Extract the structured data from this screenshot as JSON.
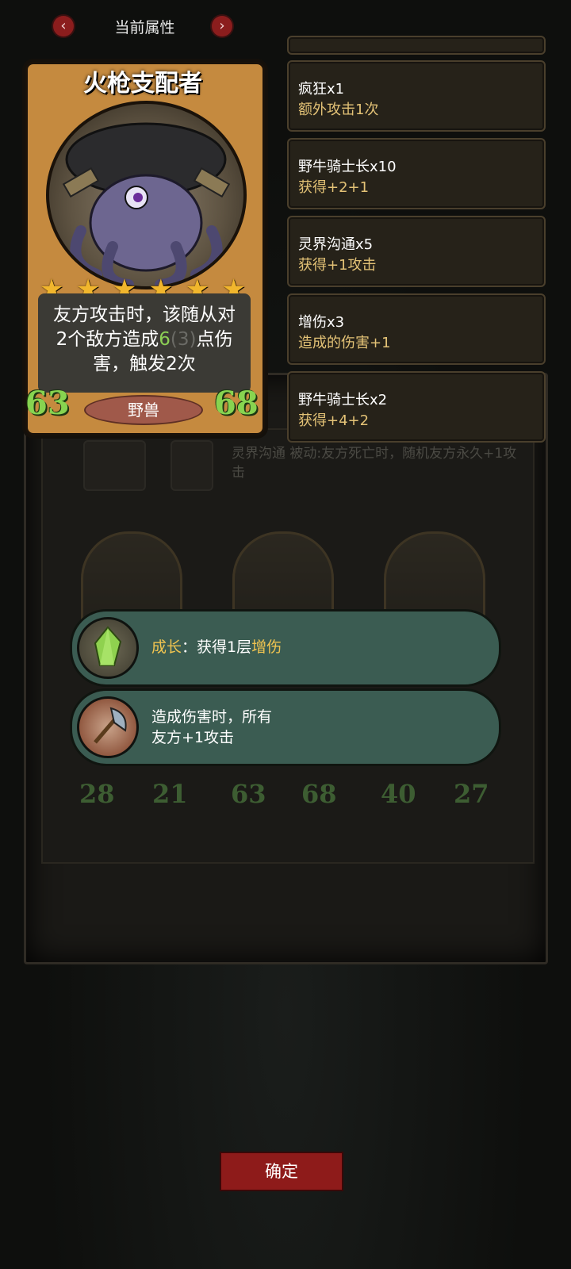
{
  "header": {
    "title": "当前属性",
    "prev_icon": "chevron-left-icon",
    "next_icon": "chevron-right-icon",
    "prev_glyph": "‹",
    "next_glyph": "›"
  },
  "hero": {
    "name": "火枪支配者",
    "stars": 6,
    "star_glyph": "★",
    "desc_1": "友方攻击时，该随从对",
    "desc_2a": "2个敌方造成",
    "desc_2b": "6",
    "desc_2c": "(3)",
    "desc_2d": "点伤",
    "desc_3": "害，触发2次",
    "attack": "63",
    "health": "68",
    "tribe": "野兽"
  },
  "buffs": [
    {
      "title": "疯狂x1",
      "effect": "额外攻击1次"
    },
    {
      "title": "野牛骑士长x10",
      "effect": "获得+2+1"
    },
    {
      "title": "灵界沟通x5",
      "effect": "获得+1攻击"
    },
    {
      "title": "增伤x3",
      "effect": "造成的伤害+1"
    },
    {
      "title": "野牛骑士长x2",
      "effect": "获得+4+2"
    }
  ],
  "background": {
    "skill_text": "灵界沟通 被动:友方死亡时，随机友方永久+1攻击",
    "cards": [
      {
        "attack": "28",
        "health": "21"
      },
      {
        "attack": "63",
        "health": "68"
      },
      {
        "attack": "40",
        "health": "27"
      }
    ]
  },
  "abilities": [
    {
      "icon": "green-crystal-icon",
      "label_a": "成长",
      "label_b": "：获得1层",
      "label_c": "增伤"
    },
    {
      "icon": "axe-icon",
      "line1": "造成伤害时，所有",
      "line2": "友方+1攻击"
    }
  ],
  "confirm_label": "确定",
  "colors": {
    "accent_red": "#8e1b1a",
    "stat_green": "#87d450",
    "buff_effect": "#e3c276",
    "banner_bg": "#3b5c52",
    "highlight_yellow": "#f0c450"
  }
}
